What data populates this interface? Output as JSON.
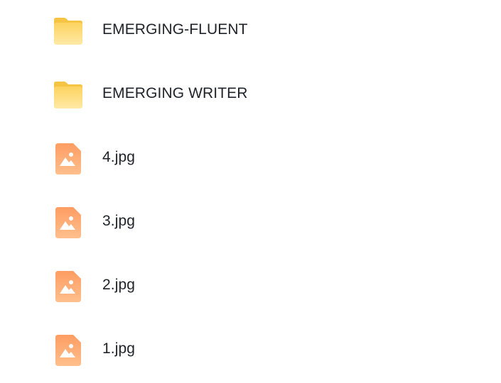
{
  "file_list": {
    "items": [
      {
        "name": "EMERGING-FLUENT",
        "type": "folder",
        "icon": "folder-icon"
      },
      {
        "name": "EMERGING WRITER",
        "type": "folder",
        "icon": "folder-icon"
      },
      {
        "name": "4.jpg",
        "type": "image",
        "icon": "image-file-icon"
      },
      {
        "name": "3.jpg",
        "type": "image",
        "icon": "image-file-icon"
      },
      {
        "name": "2.jpg",
        "type": "image",
        "icon": "image-file-icon"
      },
      {
        "name": "1.jpg",
        "type": "image",
        "icon": "image-file-icon"
      }
    ]
  },
  "colors": {
    "folder": "#fcd66a",
    "folder_light": "#ffe89a",
    "image_icon": "#fda26b",
    "image_icon_light": "#ffc08f",
    "text": "#1f2329"
  }
}
